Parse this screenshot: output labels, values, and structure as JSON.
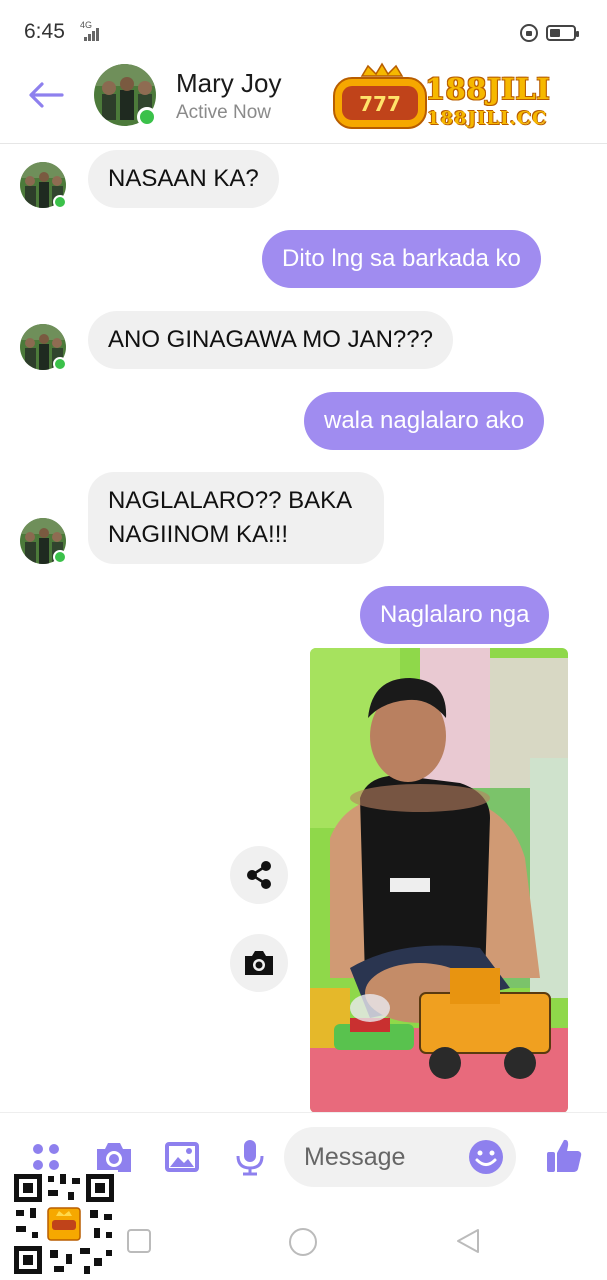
{
  "status_bar": {
    "time": "6:45",
    "network": "4G"
  },
  "header": {
    "contact_name": "Mary Joy",
    "contact_status": "Active Now",
    "back_icon": "arrow-left-icon",
    "brand": {
      "name": "188JILI",
      "url": "188JILI.CC",
      "badge_text": "777"
    }
  },
  "messages": [
    {
      "direction": "incoming",
      "text": "NASAAN KA?"
    },
    {
      "direction": "outgoing",
      "text": "Dito lng sa barkada ko"
    },
    {
      "direction": "incoming",
      "text": "ANO GINAGAWA MO JAN???"
    },
    {
      "direction": "outgoing",
      "text": "wala naglalaro ako"
    },
    {
      "direction": "incoming",
      "lines": [
        "NAGLALARO?? BAKA",
        "NAGIINOM KA!!!"
      ]
    },
    {
      "direction": "outgoing",
      "text": "Naglalaro nga"
    }
  ],
  "photo_actions": [
    "share-icon",
    "camera-icon"
  ],
  "composer": {
    "placeholder": "Message",
    "icons": [
      "apps-icon",
      "camera-icon",
      "gallery-icon",
      "microphone-icon",
      "emoji-icon",
      "thumbs-up-icon"
    ]
  },
  "colors": {
    "accent": "#a08cf0",
    "incoming_bubble": "#f0f0f0",
    "presence": "#3bc14a",
    "icon": "#8e80ee"
  }
}
